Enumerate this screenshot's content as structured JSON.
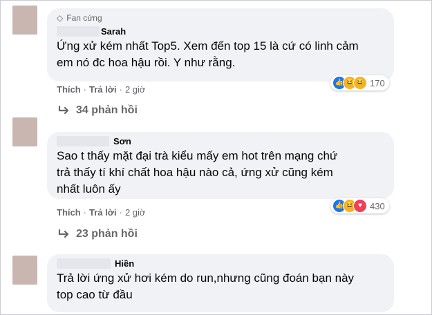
{
  "comments": [
    {
      "badge": "Fan cứng",
      "name": "Sarah",
      "text_lines": [
        "Ứng xử kém nhất Top5. Xem đến top 15 là cứ có linh cảm",
        "em nó đc hoa hậu rồi. Y như rằng."
      ],
      "like": "Thích",
      "reply": "Trả lời",
      "time": "2 giờ",
      "reaction_icons": [
        "like-icon",
        "haha-icon",
        "haha-icon"
      ],
      "reaction_count": "170",
      "replies": "34 phản hồi"
    },
    {
      "name": "Sơn",
      "text_lines": [
        "Sao t thấy mặt đại trà kiểu mấy em hot trên mạng chứ",
        "trả thấy tí khí chất hoa hậu nào cả, ứng xử cũng kém",
        "nhất luôn ấy"
      ],
      "like": "Thích",
      "reply": "Trả lời",
      "time": "2 giờ",
      "reaction_icons": [
        "like-icon",
        "haha-icon",
        "love-icon"
      ],
      "reaction_count": "430",
      "replies": "23 phản hồi"
    },
    {
      "name": "Hiền",
      "text_lines": [
        "Trả lời ứng xử hơi kém do run,nhưng cũng đoán bạn này",
        "top cao từ đầu"
      ]
    }
  ],
  "colors": {
    "bubble": "#f0f2f5",
    "meta": "#65676b",
    "like_blue": "#1877f2",
    "love_red": "#f33e58",
    "haha_yellow": "#f7b125"
  }
}
